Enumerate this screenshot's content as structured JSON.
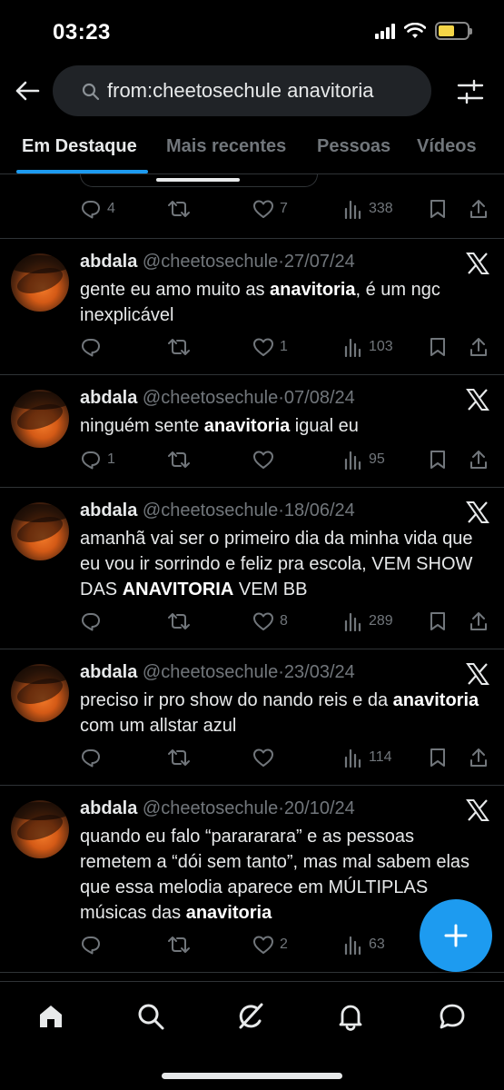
{
  "status_bar": {
    "time": "03:23"
  },
  "search": {
    "query": "from:cheetosechule anavitoria"
  },
  "tabs": [
    {
      "label": "Em Destaque",
      "active": true
    },
    {
      "label": "Mais recentes",
      "active": false
    },
    {
      "label": "Pessoas",
      "active": false
    },
    {
      "label": "Vídeos",
      "active": false
    }
  ],
  "partial_tweet": {
    "replies": "4",
    "retweets": "",
    "likes": "7",
    "views": "338"
  },
  "tweets": [
    {
      "name": "abdala",
      "handle": "@cheetosechule",
      "separator": "·",
      "date": "27/07/24",
      "text_parts": [
        {
          "text": "gente eu amo muito as ",
          "bold": false
        },
        {
          "text": "anavitoria",
          "bold": true
        },
        {
          "text": ", é um ngc inexplicável",
          "bold": false
        }
      ],
      "replies": "",
      "retweets": "",
      "likes": "1",
      "views": "103"
    },
    {
      "name": "abdala",
      "handle": "@cheetosechule",
      "separator": "·",
      "date": "07/08/24",
      "text_parts": [
        {
          "text": "ninguém sente ",
          "bold": false
        },
        {
          "text": "anavitoria",
          "bold": true
        },
        {
          "text": " igual eu",
          "bold": false
        }
      ],
      "replies": "1",
      "retweets": "",
      "likes": "",
      "views": "95"
    },
    {
      "name": "abdala",
      "handle": "@cheetosechule",
      "separator": "·",
      "date": "18/06/24",
      "text_parts": [
        {
          "text": "amanhã vai ser o primeiro dia da minha vida que eu vou ir sorrindo e feliz pra escola, VEM SHOW DAS ",
          "bold": false
        },
        {
          "text": "ANAVITORIA",
          "bold": true
        },
        {
          "text": " VEM BB",
          "bold": false
        }
      ],
      "replies": "",
      "retweets": "",
      "likes": "8",
      "views": "289"
    },
    {
      "name": "abdala",
      "handle": "@cheetosechule",
      "separator": "·",
      "date": "23/03/24",
      "text_parts": [
        {
          "text": "preciso ir pro show do nando reis e da ",
          "bold": false
        },
        {
          "text": "anavitoria",
          "bold": true
        },
        {
          "text": " com um allstar azul",
          "bold": false
        }
      ],
      "replies": "",
      "retweets": "",
      "likes": "",
      "views": "114"
    },
    {
      "name": "abdala",
      "handle": "@cheetosechule",
      "separator": "·",
      "date": "20/10/24",
      "text_parts": [
        {
          "text": "quando eu falo “parararara” e as pessoas remetem a “dói sem tanto”, mas mal sabem elas que essa melodia aparece em MÚLTIPLAS músicas das ",
          "bold": false
        },
        {
          "text": "anavitoria",
          "bold": true
        }
      ],
      "replies": "",
      "retweets": "",
      "likes": "2",
      "views": "63"
    }
  ],
  "nav": [
    "home-icon",
    "search-icon",
    "grok-icon",
    "notifications-icon",
    "messages-icon"
  ],
  "colors": {
    "accent": "#1d9bf0",
    "muted": "#71767b",
    "divider": "#2f3336",
    "background": "#000000"
  }
}
